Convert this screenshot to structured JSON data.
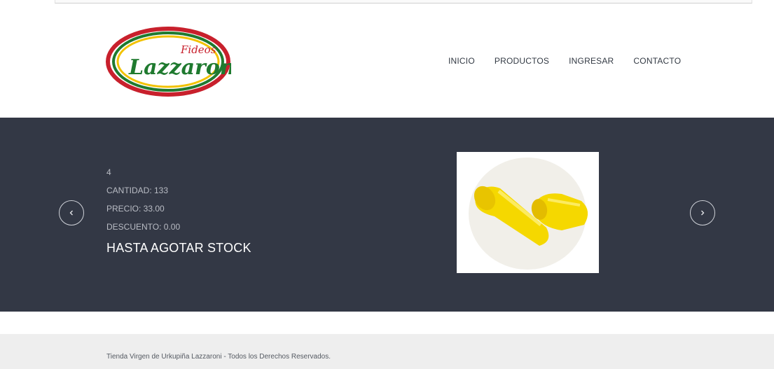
{
  "brand": {
    "logo_top": "Fideos",
    "logo_main": "Lazzaroni"
  },
  "nav": {
    "items": [
      {
        "label": "INICIO"
      },
      {
        "label": "PRODUCTOS"
      },
      {
        "label": "INGRESAR"
      },
      {
        "label": "CONTACTO"
      }
    ]
  },
  "slide": {
    "id": "4",
    "cantidad": "CANTIDAD: 133",
    "precio": "PRECIO: 33.00",
    "descuento": "DESCUENTO: 0.00",
    "headline": "HASTA AGOTAR STOCK"
  },
  "icons": {
    "prev": "chevron-left-icon",
    "next": "chevron-right-icon"
  },
  "colors": {
    "banner_bg": "#333845",
    "footer_bg": "#eeeeee",
    "pasta": "#f5d800",
    "logo_red": "#c8202c",
    "logo_green": "#1f7a2f",
    "logo_yellow": "#f2c200"
  },
  "footer": {
    "copyright": "Tienda Virgen de Urkupiña Lazzaroni - Todos los Derechos Reservados."
  }
}
